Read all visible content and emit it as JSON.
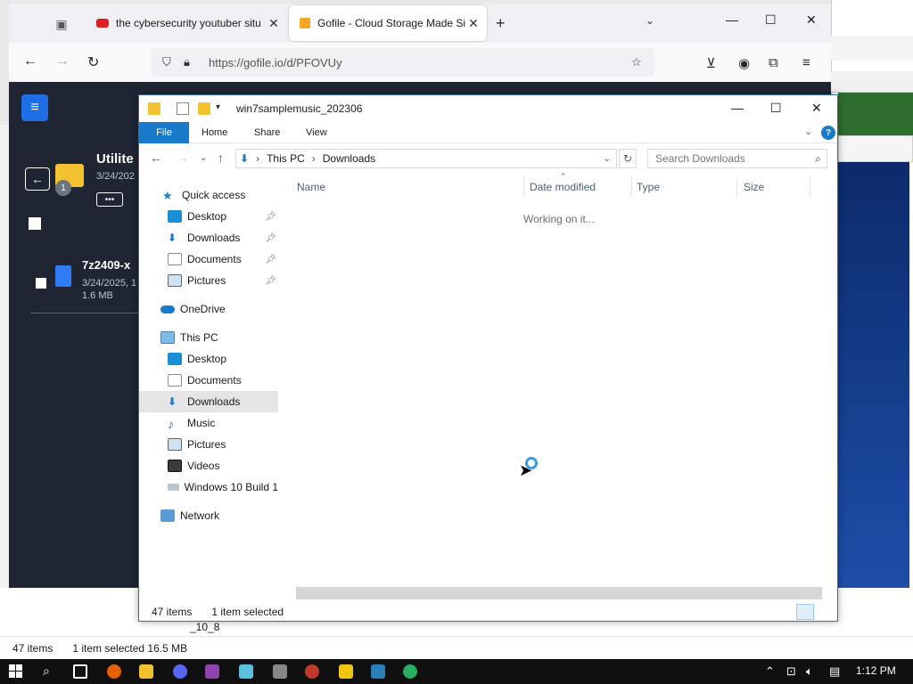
{
  "browser": {
    "tabs": [
      {
        "title": "the cybersecurity youtuber situ",
        "icon": "youtube-icon"
      },
      {
        "title": "Gofile - Cloud Storage Made Si",
        "icon": "gofile-icon"
      }
    ],
    "url": "https://gofile.io/d/PFOVUy"
  },
  "gofile": {
    "folder_name": "Utilite",
    "folder_date": "3/24/202",
    "folder_badge": "1",
    "more_label": "•••",
    "file": {
      "name": "7z2409-x",
      "date": "3/24/2025, 1",
      "size": "1.6 MB"
    }
  },
  "explorer": {
    "title": "win7samplemusic_202306",
    "ribbon_tabs": [
      "File",
      "Home",
      "Share",
      "View"
    ],
    "breadcrumb": [
      "This PC",
      "Downloads"
    ],
    "search_placeholder": "Search Downloads",
    "nav": {
      "quick_access": "Quick access",
      "quick_items": [
        "Desktop",
        "Downloads",
        "Documents",
        "Pictures"
      ],
      "onedrive": "OneDrive",
      "this_pc": "This PC",
      "pc_items": [
        "Desktop",
        "Documents",
        "Downloads",
        "Music",
        "Pictures",
        "Videos",
        "Windows 10 Build 1"
      ],
      "network": "Network"
    },
    "columns": [
      "Name",
      "Date modified",
      "Type",
      "Size"
    ],
    "status_message": "Working on it...",
    "status": {
      "items": "47 items",
      "selected": "1 item selected"
    }
  },
  "background_window": {
    "items": "47 items",
    "selected": "1 item selected 16.5 MB",
    "label": "_10_8"
  },
  "taskbar": {
    "time": "1:12 PM"
  },
  "colors": {
    "accent": "#1979ca",
    "gofile_bg": "#1f2533",
    "gofile_button": "#1e6fe6"
  }
}
